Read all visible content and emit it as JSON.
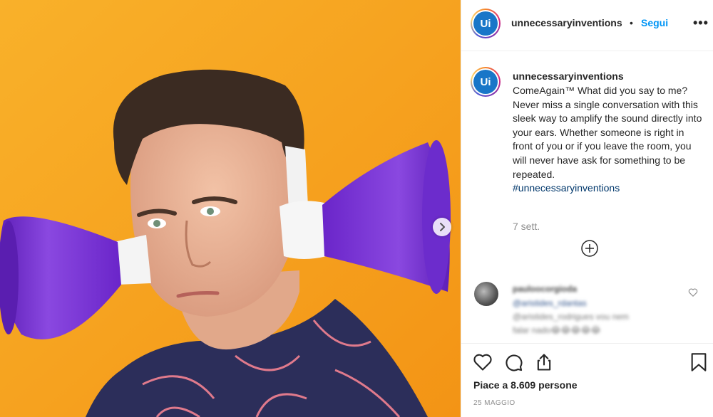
{
  "post": {
    "username": "unnecessaryinventions",
    "separator": "•",
    "follow_label": "Segui",
    "more_label": "•••",
    "avatar_text": "Ui",
    "caption_username": "unnecessaryinventions",
    "caption_text": "ComeAgain™ What did you say to me? Never miss a single conversation with this sleek way to amplify the sound directly into your ears. Whether someone is right in front of you or if you leave the room, you will never have ask for something to be repeated.",
    "caption_hashtag": "#unnecessaryinventions",
    "time_ago": "7 sett.",
    "likes_text": "Piace a 8.609 persone",
    "date_text": "25 MAGGIO"
  },
  "comment": {
    "username": "pauloocorgioda",
    "line1": "@aristides_rdantas",
    "line2": "@aristides_rodrigues vou nem",
    "line3": "falar nado😂😂😂😂😂"
  },
  "icons": {
    "heart": "heart-icon",
    "comment": "comment-icon",
    "share": "share-icon",
    "bookmark": "bookmark-icon",
    "add": "plus-circle-icon",
    "next": "chevron-right-icon"
  },
  "colors": {
    "photo_background": "#f7a51d",
    "cone_purple": "#7b35d6",
    "link_blue": "#0095f6",
    "hashtag": "#00376b",
    "avatar_blue": "#1976c8"
  }
}
